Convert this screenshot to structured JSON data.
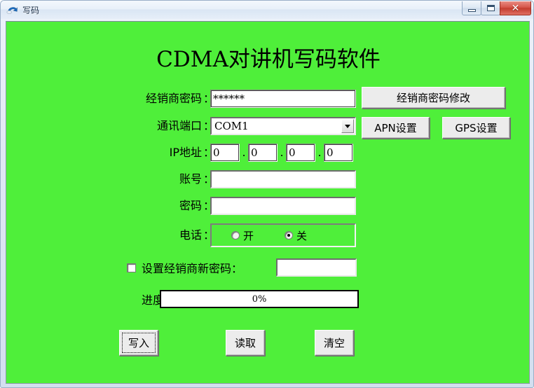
{
  "window": {
    "title": "写码",
    "icon": "back-arrow-icon",
    "controls": {
      "minimize": "–",
      "maximize": "□",
      "close": "✕"
    }
  },
  "theme": {
    "client_background": "#4FEF3A",
    "title_text": "#1b2f47",
    "close_button": "#c33c2e"
  },
  "app": {
    "heading": "CDMA对讲机写码软件"
  },
  "form": {
    "colon": "：",
    "dot": ".",
    "rows": [
      {
        "label": "经销商密码",
        "colon": "：",
        "value": "******",
        "placeholder": ""
      },
      {
        "label": "通讯端口 ",
        "colon": "：",
        "value": "COM1",
        "placeholder": ""
      },
      {
        "label": "IP地址",
        "colon": "：",
        "value": "",
        "placeholder": ""
      },
      {
        "label": "账号",
        "colon": "：",
        "value": "",
        "placeholder": ""
      },
      {
        "label": "密码",
        "colon": "：",
        "value": "",
        "placeholder": ""
      },
      {
        "label": "电话",
        "colon": "：",
        "value": "",
        "placeholder": ""
      }
    ],
    "ip_octets": [
      "0",
      "0",
      "0",
      "0"
    ],
    "phone_options": [
      {
        "label": "开",
        "selected": false
      },
      {
        "label": "关",
        "selected": true
      }
    ],
    "new_password": {
      "checkbox_checked": false,
      "label": "设置经销商新密码：",
      "value": "",
      "placeholder": ""
    },
    "progress": {
      "label": "进度：",
      "text": "0%",
      "percent": 0
    }
  },
  "side_buttons": [
    {
      "label": "经销商密码修改"
    },
    {
      "label": "APN设置"
    },
    {
      "label": "GPS设置"
    }
  ],
  "action_buttons": [
    {
      "label": "写入",
      "focused": true
    },
    {
      "label": "读取",
      "focused": false
    },
    {
      "label": "清空",
      "focused": false
    }
  ]
}
